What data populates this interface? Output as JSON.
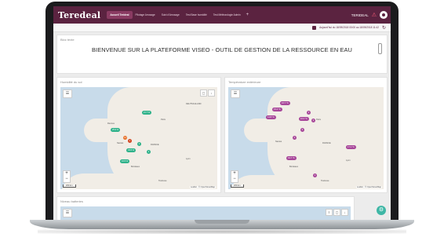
{
  "app": {
    "logo": "Teredeal",
    "tabs": [
      {
        "label": "Accueil Terideal",
        "active": true
      },
      {
        "label": "Pilotage Arrosage",
        "active": false
      },
      {
        "label": "Suivi d'Arrosage",
        "active": false
      },
      {
        "label": "Test Base humidité",
        "active": false
      },
      {
        "label": "Test Météorologie Admin",
        "active": false
      }
    ],
    "add_tab": "+",
    "user": "TERIDEAL",
    "accent": "#5b2340"
  },
  "subbar": {
    "update_text": "Aujourd'hui du 18/09/2018 00:00 au 18/09/2018 11:42"
  },
  "banner": {
    "label": "Bloc texte",
    "title": "BIENVENUE SUR LA PLATEFORME VISEO - OUTIL DE GESTION DE LA RESSOURCE EN EAU"
  },
  "panels": {
    "humidity": {
      "title": "Humidité du sol",
      "markers": [
        {
          "label": "21.7 %",
          "color": "#2fb28a"
        },
        {
          "label": "25.9 %",
          "color": "#2fb28a"
        },
        {
          "label": "33.5 %",
          "color": "#2fb28a"
        },
        {
          "label": "16.5 %",
          "color": "#2fb28a"
        }
      ],
      "dots": [
        "12",
        "4",
        "3",
        "2"
      ],
      "cities": [
        "Rennes",
        "Nantes",
        "FRANCE",
        "Bordeaux",
        "Toulouse",
        "Lyon",
        "Paris",
        "DEUTSCHLAND"
      ]
    },
    "temperature": {
      "title": "Température extérieure",
      "markers": [
        {
          "label": "16.7 °C",
          "color": "#a8479a"
        },
        {
          "label": "15.4 °C",
          "color": "#a8479a"
        },
        {
          "label": "14.8 °C",
          "color": "#a8479a"
        },
        {
          "label": "16.2 °C",
          "color": "#a8479a"
        },
        {
          "label": "17.1 °C",
          "color": "#a8479a"
        },
        {
          "label": "19.7 °C",
          "color": "#a8479a"
        }
      ],
      "dots": [
        "2",
        "3",
        "5",
        "3",
        "2"
      ],
      "cities": [
        "Paris",
        "Nantes",
        "FRANCE",
        "Bordeaux",
        "Toulouse",
        "Lyon"
      ]
    },
    "third": {
      "title": "Niveau batteries"
    }
  },
  "map_controls": {
    "zoom_in": "+",
    "zoom_out": "−",
    "scale_label": "200 km",
    "attribution": "Leaflet · © OpenStreetMap"
  },
  "fab": {
    "icon": "gear-icon",
    "color": "#3fb7a6"
  }
}
